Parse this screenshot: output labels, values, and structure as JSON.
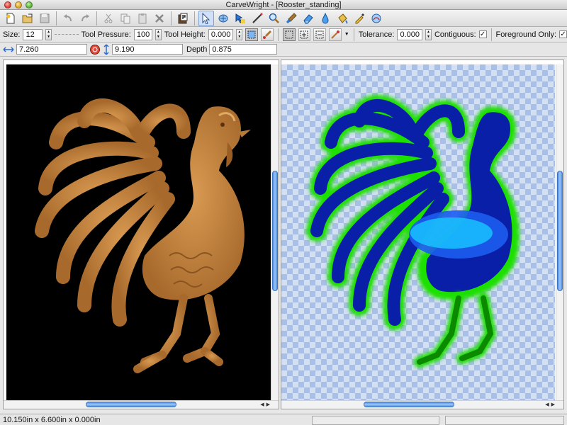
{
  "window": {
    "title": "CarveWright - [Rooster_standing]"
  },
  "toolbar": {
    "icons": [
      "new-file-icon",
      "open-folder-icon",
      "save-icon",
      "undo-icon",
      "redo-icon",
      "cut-icon",
      "copy-icon",
      "paste-icon",
      "delete-icon",
      "patterns-icon",
      "select-arrow-icon",
      "transform-icon",
      "select-region-icon",
      "line-tool-icon",
      "zoom-icon",
      "paintbrush-icon",
      "eraser-icon",
      "dropper-icon",
      "paint-bucket-icon",
      "color-picker-icon",
      "blend-icon"
    ],
    "active_tool": "select-arrow-icon"
  },
  "options": {
    "size_label": "Size:",
    "size_value": "12",
    "pressure_label": "Tool Pressure:",
    "pressure_value": "100",
    "height_label": "Tool Height:",
    "height_value": "0.000",
    "tolerance_label": "Tolerance:",
    "tolerance_value": "0.000",
    "contiguous_label": "Contiguous:",
    "contiguous_checked": true,
    "foreground_label": "Foreground Only:",
    "foreground_checked": true
  },
  "coords": {
    "width_value": "7.260",
    "height_value": "9.190",
    "depth_label": "Depth",
    "depth_value": "0.875"
  },
  "views": {
    "left": {
      "name": "carved-render",
      "background": "#000000",
      "relief_color": "#c8843e"
    },
    "right": {
      "name": "depth-map",
      "background_checker": [
        "#d3dff2",
        "#a9bfe6"
      ],
      "colors": [
        "#0a1fa8",
        "#1c5df0",
        "#18c8ff",
        "#1fe000"
      ]
    }
  },
  "status": {
    "dimensions": "10.150in x 6.600in x 0.000in"
  }
}
